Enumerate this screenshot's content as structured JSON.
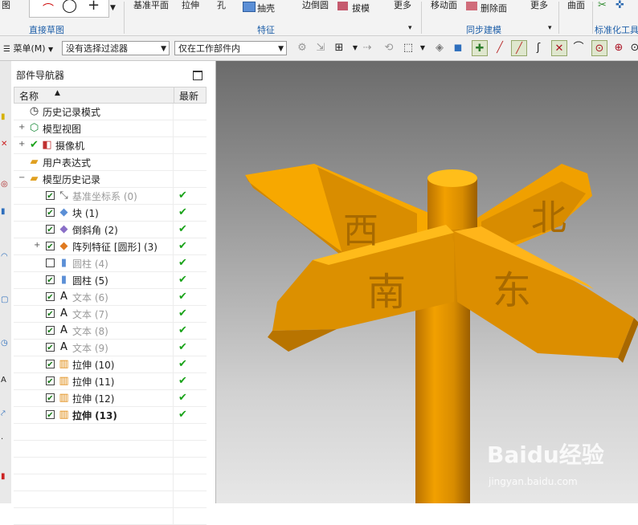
{
  "ribbon": {
    "top_labels": {
      "sketch_group_partial": "图",
      "datum_plane": "基准平面",
      "extrude": "拉伸",
      "hole": "孔",
      "shell": "抽壳",
      "edge_blend": "边倒圆",
      "draft": "拔模",
      "more1": "更多",
      "move_face": "移动面",
      "delete_face": "删除面",
      "more2": "更多",
      "surface": "曲面"
    },
    "groups": {
      "direct_sketch": "直接草图",
      "feature": "特征",
      "sync_modeling": "同步建模",
      "standard_tools": "标准化工具"
    }
  },
  "toolbar": {
    "menu_label": "菜单(M)",
    "filter_select": "没有选择过滤器",
    "scope_select": "仅在工作部件内"
  },
  "navigator": {
    "title": "部件导航器",
    "col_name": "名称",
    "col_latest": "最新",
    "rows": [
      {
        "label": "历史记录模式",
        "icon": "clock-icon",
        "indent": 1,
        "checked": null,
        "latest": false,
        "dim": false,
        "bold": false,
        "expand": false
      },
      {
        "label": "模型视图",
        "icon": "model-views-icon",
        "indent": 1,
        "checked": null,
        "latest": false,
        "dim": false,
        "bold": false,
        "expand": true
      },
      {
        "label": "摄像机",
        "icon": "camera-icon",
        "indent": 1,
        "checked": "tick",
        "latest": false,
        "dim": false,
        "bold": false,
        "expand": true
      },
      {
        "label": "用户表达式",
        "icon": "folder-icon",
        "indent": 1,
        "checked": null,
        "latest": false,
        "dim": false,
        "bold": false,
        "expand": false
      },
      {
        "label": "模型历史记录",
        "icon": "folder-open-icon",
        "indent": 1,
        "checked": null,
        "latest": false,
        "dim": false,
        "bold": false,
        "expand": "minus"
      },
      {
        "label": "基准坐标系 (0)",
        "icon": "datum-csys-icon",
        "indent": 2,
        "checked": true,
        "latest": true,
        "dim": true,
        "bold": false,
        "expand": false
      },
      {
        "label": "块 (1)",
        "icon": "block-icon",
        "indent": 2,
        "checked": true,
        "latest": true,
        "dim": false,
        "bold": false,
        "expand": false
      },
      {
        "label": "倒斜角 (2)",
        "icon": "chamfer-icon",
        "indent": 2,
        "checked": true,
        "latest": true,
        "dim": false,
        "bold": false,
        "expand": false
      },
      {
        "label": "阵列特征 [圆形] (3)",
        "icon": "pattern-icon",
        "indent": 2,
        "checked": true,
        "latest": true,
        "dim": false,
        "bold": false,
        "expand": true
      },
      {
        "label": "圆柱 (4)",
        "icon": "cylinder-icon",
        "indent": 2,
        "checked": false,
        "latest": true,
        "dim": true,
        "bold": false,
        "expand": false
      },
      {
        "label": "圆柱 (5)",
        "icon": "cylinder-icon",
        "indent": 2,
        "checked": true,
        "latest": true,
        "dim": false,
        "bold": false,
        "expand": false
      },
      {
        "label": "文本 (6)",
        "icon": "text-icon",
        "indent": 2,
        "checked": true,
        "latest": true,
        "dim": true,
        "bold": false,
        "expand": false
      },
      {
        "label": "文本 (7)",
        "icon": "text-icon",
        "indent": 2,
        "checked": true,
        "latest": true,
        "dim": true,
        "bold": false,
        "expand": false
      },
      {
        "label": "文本 (8)",
        "icon": "text-icon",
        "indent": 2,
        "checked": true,
        "latest": true,
        "dim": true,
        "bold": false,
        "expand": false
      },
      {
        "label": "文本 (9)",
        "icon": "text-icon",
        "indent": 2,
        "checked": true,
        "latest": true,
        "dim": true,
        "bold": false,
        "expand": false
      },
      {
        "label": "拉伸 (10)",
        "icon": "extrude-icon",
        "indent": 2,
        "checked": true,
        "latest": true,
        "dim": false,
        "bold": false,
        "expand": false
      },
      {
        "label": "拉伸 (11)",
        "icon": "extrude-icon",
        "indent": 2,
        "checked": true,
        "latest": true,
        "dim": false,
        "bold": false,
        "expand": false
      },
      {
        "label": "拉伸 (12)",
        "icon": "extrude-icon",
        "indent": 2,
        "checked": true,
        "latest": true,
        "dim": false,
        "bold": false,
        "expand": false
      },
      {
        "label": "拉伸 (13)",
        "icon": "extrude-icon",
        "indent": 2,
        "checked": true,
        "latest": true,
        "dim": false,
        "bold": true,
        "expand": false
      }
    ]
  },
  "model": {
    "sign_north": "北",
    "sign_south": "南",
    "sign_east": "东",
    "sign_west": "西",
    "colors": {
      "signpost": "#f7a800",
      "signpost_dark": "#c97e00",
      "signpost_light": "#ffc21a"
    }
  },
  "watermark": {
    "brand": "Baidu经验",
    "url": "jingyan.baidu.com"
  }
}
